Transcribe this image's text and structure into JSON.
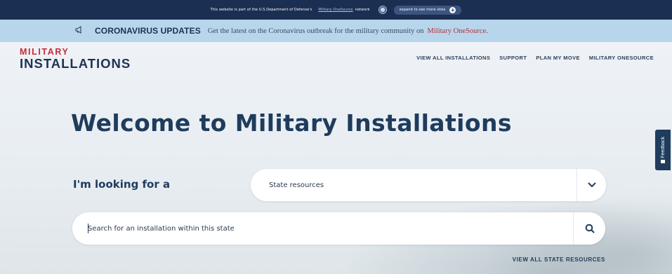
{
  "dod_bar": {
    "text": "This website is part of the U.S.Department of Defense's",
    "link": "Military OneSource",
    "suffix": "network",
    "expand_label": "expand to see more sites",
    "expand_icon": "plus-icon"
  },
  "covid_banner": {
    "icon": "megaphone-icon",
    "title": "CORONAVIRUS UPDATES",
    "text": "Get the latest on the Coronavirus outbreak for the military community on",
    "link": "Military OneSource",
    "period": "."
  },
  "logo": {
    "line1": "MILITARY",
    "line2": "INSTALLATIONS"
  },
  "nav": {
    "items": [
      "VIEW ALL INSTALLATIONS",
      "SUPPORT",
      "PLAN MY MOVE",
      "MILITARY ONESOURCE"
    ]
  },
  "hero": {
    "headline": "Welcome to Military Installations",
    "looking_label": "I'm looking for a",
    "select_value": "State resources",
    "search_placeholder": "Search for an installation within this state",
    "view_all_state": "VIEW ALL STATE RESOURCES"
  },
  "feedback": {
    "label": "Feedback"
  },
  "colors": {
    "navy": "#1b2f52",
    "banner": "#b7d6ec",
    "brand_red": "#c42b3a",
    "heading": "#1f3c5c"
  }
}
